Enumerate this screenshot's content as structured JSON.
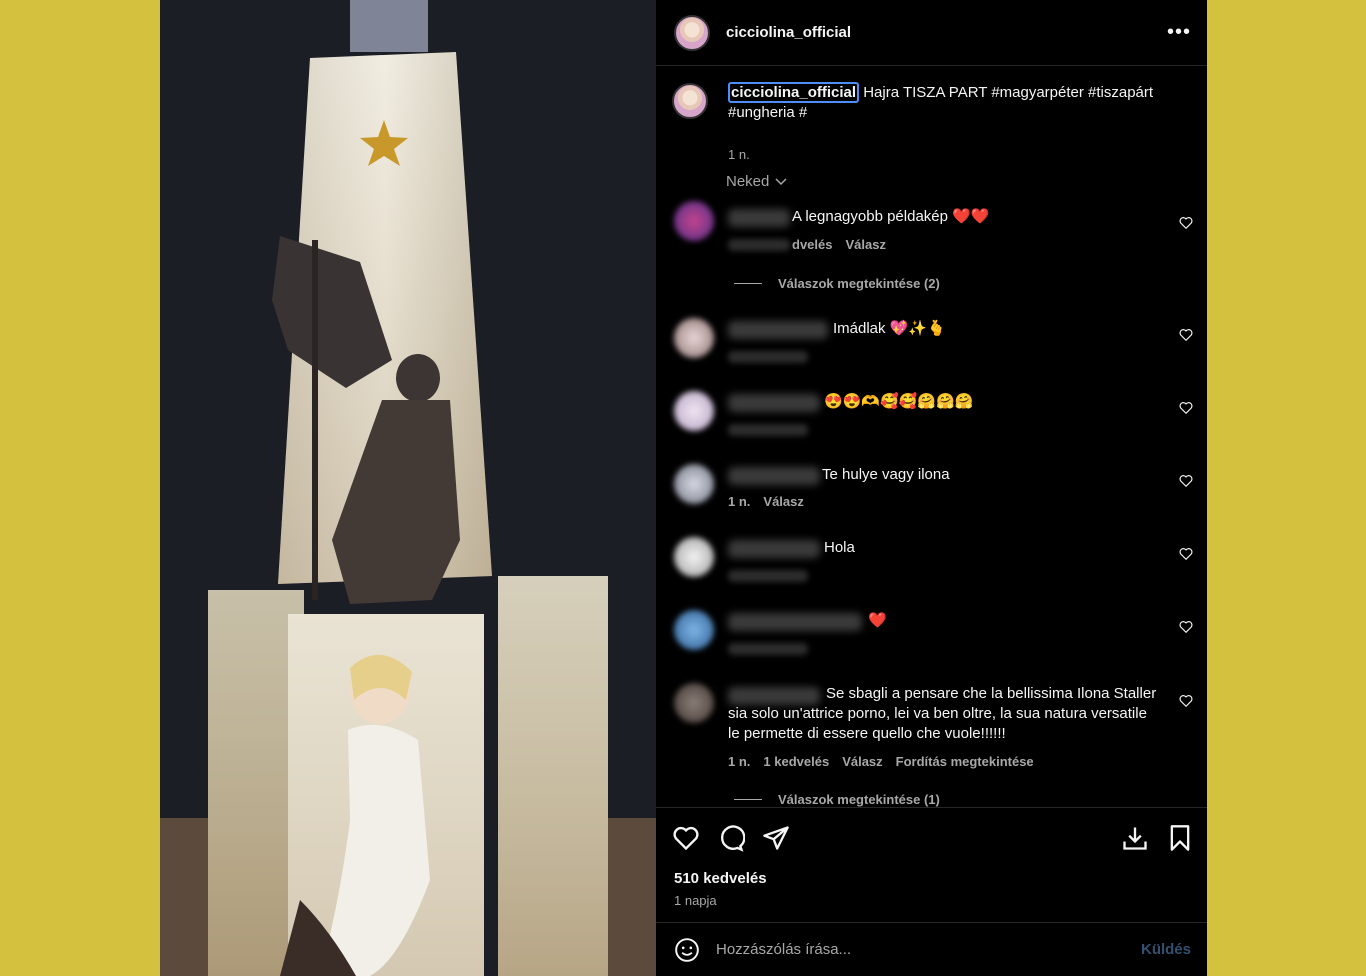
{
  "post": {
    "username": "cicciolina_official",
    "more_icon": "more-horizontal-icon",
    "caption_text": " Hajra TISZA PART #magyarpéter #tiszapárt #ungheria #",
    "caption_time": "1 n.",
    "sort_label": "Neked"
  },
  "comments": [
    {
      "text": "A legnagyobb példakép ❤️❤️",
      "meta_likes": "dvelés",
      "meta_reply": "Válasz",
      "replies": "Válaszok megtekintése (2)"
    },
    {
      "text": "Imádlak 💖✨🫰"
    },
    {
      "text": "😍😍🫶🥰🥰🤗🤗🤗"
    },
    {
      "text": "Te hulye vagy ilona",
      "meta_time": "1 n.",
      "meta_reply": "Válasz"
    },
    {
      "text": "Hola"
    },
    {
      "text": "❤️"
    },
    {
      "text": "Se sbagli a pensare che la bellissima Ilona Staller sia solo un'attrice porno, lei va ben oltre, la sua natura versatile le permette di essere quello che vuole!!!!!!",
      "meta_time": "1 n.",
      "meta_likes": "1 kedvelés",
      "meta_reply": "Válasz",
      "meta_translate": "Fordítás megtekintése",
      "replies": "Válaszok megtekintése (1)"
    }
  ],
  "footer": {
    "likes": "510 kedvelés",
    "date": "1 napja",
    "comment_placeholder": "Hozzászólás írása...",
    "send_label": "Küldés"
  },
  "colors": {
    "background": "#d4c23e",
    "panel": "#000000",
    "accent_border": "#4d8ef7",
    "send_disabled": "#35506f"
  }
}
